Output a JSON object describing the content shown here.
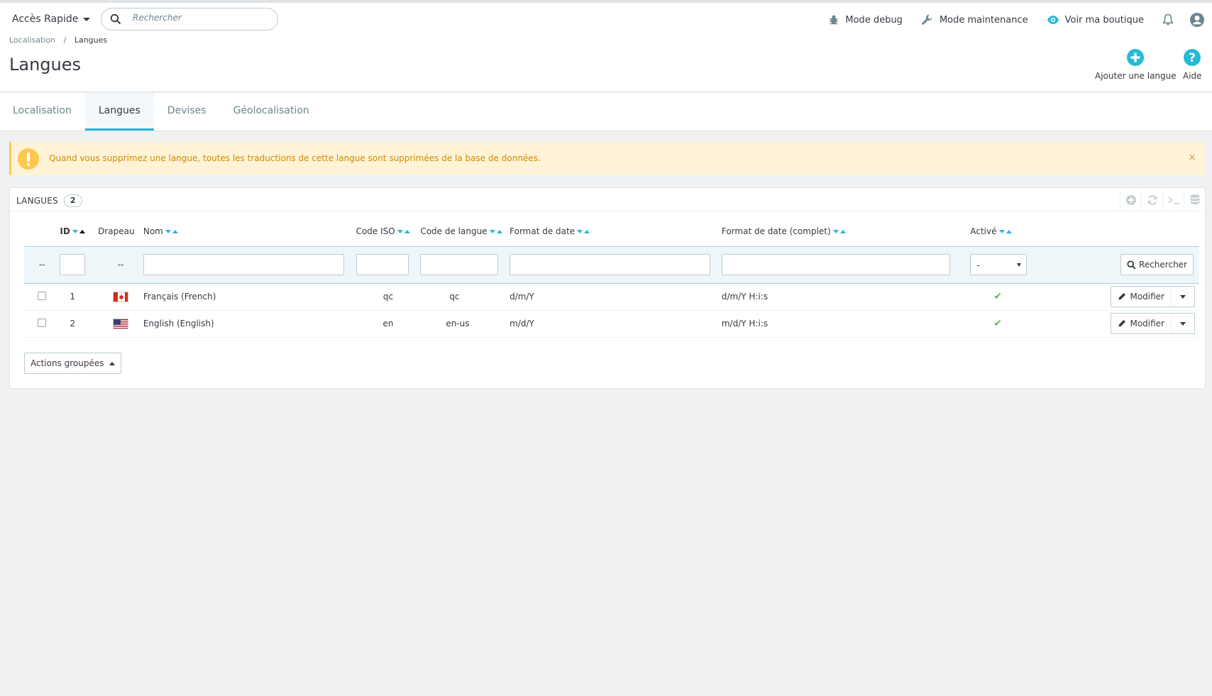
{
  "topbar": {
    "quick_access": "Accès Rapide",
    "search_placeholder": "Rechercher",
    "links": {
      "debug": "Mode debug",
      "maintenance": "Mode maintenance",
      "shop": "Voir ma boutique"
    }
  },
  "breadcrumb": {
    "parent": "Localisation",
    "sep": "/",
    "current": "Langues"
  },
  "header": {
    "title": "Langues",
    "add_label": "Ajouter une langue",
    "help_label": "Aide"
  },
  "tabs": [
    {
      "label": "Localisation",
      "active": false
    },
    {
      "label": "Langues",
      "active": true
    },
    {
      "label": "Devises",
      "active": false
    },
    {
      "label": "Géolocalisation",
      "active": false
    }
  ],
  "alert": {
    "message": "Quand vous supprimez une langue, toutes les traductions de cette langue sont supprimées de la base de données.",
    "close": "×"
  },
  "panel": {
    "title": "LANGUES",
    "count": "2",
    "columns": {
      "id": "ID",
      "flag": "Drapeau",
      "name": "Nom",
      "iso": "Code ISO",
      "lang_code": "Code de langue",
      "date_format": "Format de date",
      "date_format_full": "Format de date (complet)",
      "active": "Activé"
    },
    "filters": {
      "select_all": "--",
      "flag": "--",
      "active_value": "-",
      "search_button": "Rechercher"
    },
    "rows": [
      {
        "id": "1",
        "flag": "CA",
        "name": "Français (French)",
        "iso": "qc",
        "lang_code": "qc",
        "date_format": "d/m/Y",
        "date_format_full": "d/m/Y H:i:s",
        "active": "✔",
        "action": "Modifier"
      },
      {
        "id": "2",
        "flag": "US",
        "name": "English (English)",
        "iso": "en",
        "lang_code": "en-us",
        "date_format": "m/d/Y",
        "date_format_full": "m/d/Y H:i:s",
        "active": "✔",
        "action": "Modifier"
      }
    ],
    "bulk_actions": "Actions groupées"
  },
  "colors": {
    "accent": "#25b9d7",
    "warning": "#fcc94f",
    "success": "#5cb85c"
  }
}
